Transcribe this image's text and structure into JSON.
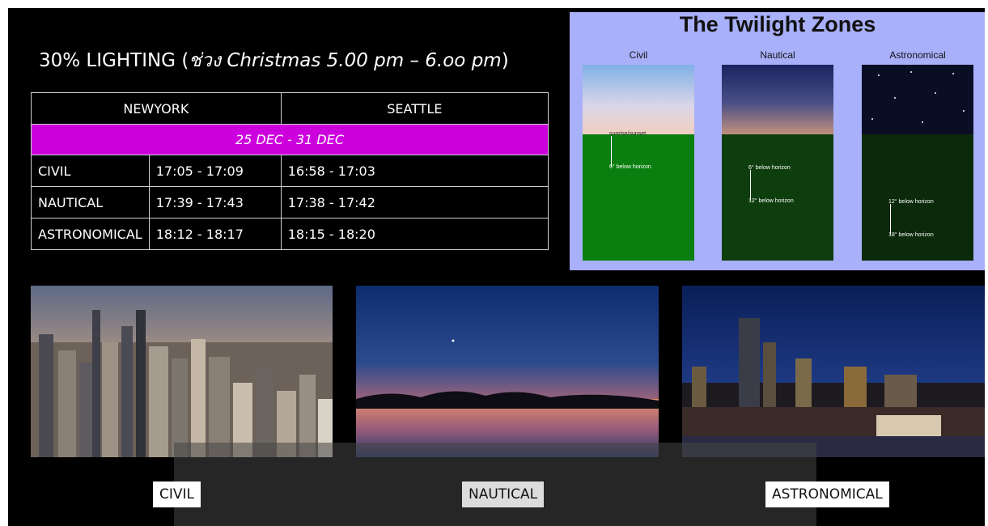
{
  "slide": {
    "heading_main": "30% LIGHTING (",
    "heading_thai": "ช่วง Christmas 5.00 pm – 6.oo pm",
    "heading_close": ")"
  },
  "table": {
    "cities": [
      "NEWYORK",
      "SEATTLE"
    ],
    "date_range": "25 DEC - 31 DEC",
    "rows": [
      {
        "zone": "CIVIL",
        "newyork": "17:05 - 17:09",
        "seattle": "16:58 - 17:03"
      },
      {
        "zone": "NAUTICAL",
        "newyork": "17:39 - 17:43",
        "seattle": "17:38 - 17:42"
      },
      {
        "zone": "ASTRONOMICAL",
        "newyork": "18:12 - 18:17",
        "seattle": "18:15 - 18:20"
      }
    ]
  },
  "diagram": {
    "title": "The Twilight Zones",
    "columns": [
      "Civil",
      "Nautical",
      "Astronomical"
    ],
    "civil_top": "sunrise/sunset",
    "civil_bottom": "6° below horizon",
    "nautical_top": "6° below horizon",
    "nautical_bottom": "12° below horizon",
    "astro_top": "12° below horizon",
    "astro_bottom": "18° below horizon"
  },
  "captions": {
    "civil": "CIVIL",
    "nautical": "NAUTICAL",
    "astronomical": "ASTRONOMICAL"
  },
  "colors": {
    "date_band": "#cc00dd",
    "diagram_bg": "#a9b0fa",
    "civil_ground": "#0a7f10",
    "nautical_ground": "#0e3e0e",
    "astro_ground": "#0a2a0a"
  }
}
